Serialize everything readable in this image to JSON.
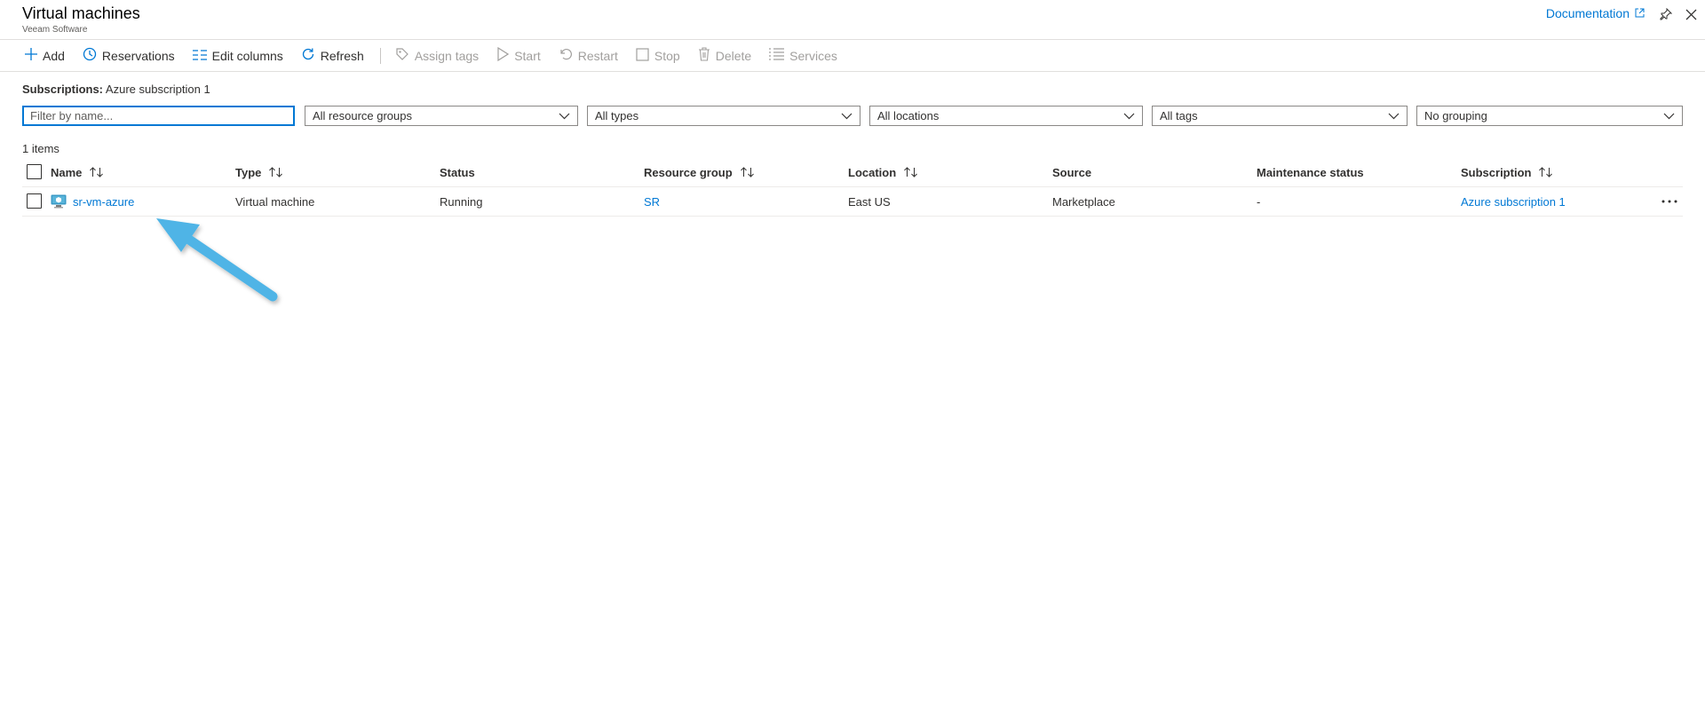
{
  "header": {
    "title": "Virtual machines",
    "subtitle": "Veeam Software",
    "documentation_label": "Documentation"
  },
  "toolbar": {
    "add": "Add",
    "reservations": "Reservations",
    "edit_columns": "Edit columns",
    "refresh": "Refresh",
    "assign_tags": "Assign tags",
    "start": "Start",
    "restart": "Restart",
    "stop": "Stop",
    "delete": "Delete",
    "services": "Services"
  },
  "subscriptions": {
    "label": "Subscriptions:",
    "value": "Azure subscription 1"
  },
  "filters": {
    "name_placeholder": "Filter by name...",
    "resource_groups": "All resource groups",
    "types": "All types",
    "locations": "All locations",
    "tags": "All tags",
    "grouping": "No grouping"
  },
  "grid": {
    "count_label": "1 items",
    "columns": {
      "name": "Name",
      "type": "Type",
      "status": "Status",
      "resource_group": "Resource group",
      "location": "Location",
      "source": "Source",
      "maintenance_status": "Maintenance status",
      "subscription": "Subscription"
    },
    "rows": [
      {
        "name": "sr-vm-azure",
        "type": "Virtual machine",
        "status": "Running",
        "resource_group": "SR",
        "location": "East US",
        "source": "Marketplace",
        "maintenance_status": "-",
        "subscription": "Azure subscription 1"
      }
    ]
  },
  "colors": {
    "accent": "#0078d4",
    "annotation_arrow": "#4fb4e6",
    "disabled_text": "#a19f9d"
  },
  "icons": {
    "add": "plus-icon",
    "reservations": "clock-icon",
    "edit_columns": "columns-icon",
    "refresh": "refresh-icon",
    "assign_tags": "tag-icon",
    "start": "play-icon",
    "restart": "restart-icon",
    "stop": "stop-icon",
    "delete": "trash-icon",
    "services": "list-icon",
    "row": "virtual-machine-icon"
  }
}
